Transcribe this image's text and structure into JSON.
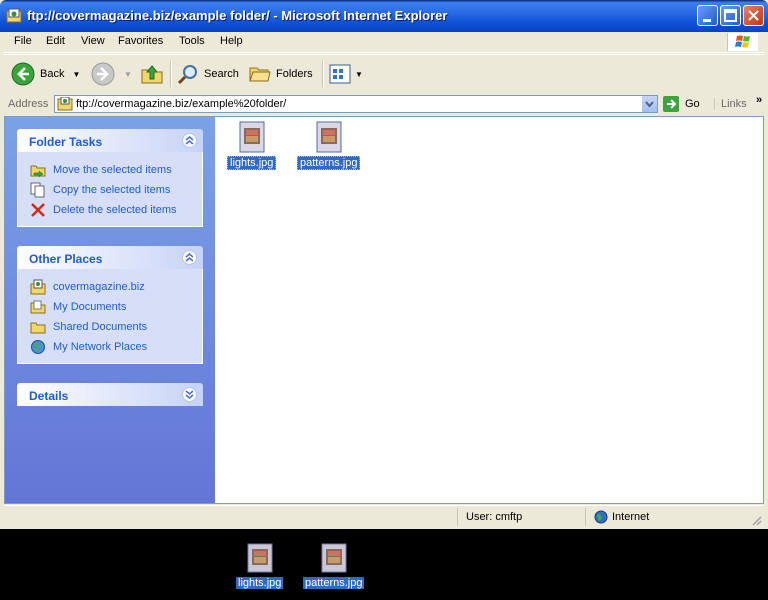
{
  "window": {
    "title": "ftp://covermagazine.biz/example folder/ - Microsoft Internet Explorer"
  },
  "menu": {
    "items": [
      "File",
      "Edit",
      "View",
      "Favorites",
      "Tools",
      "Help"
    ]
  },
  "toolbar": {
    "back_label": "Back",
    "search_label": "Search",
    "folders_label": "Folders"
  },
  "address": {
    "label": "Address",
    "url": "ftp://covermagazine.biz/example%20folder/",
    "go_label": "Go",
    "links_label": "Links"
  },
  "folder_tasks": {
    "title": "Folder Tasks",
    "items": [
      {
        "label": "Move the selected items",
        "icon": "move-icon"
      },
      {
        "label": "Copy the selected items",
        "icon": "copy-icon"
      },
      {
        "label": "Delete the selected items",
        "icon": "delete-icon"
      }
    ]
  },
  "other_places": {
    "title": "Other Places",
    "items": [
      {
        "label": "covermagazine.biz",
        "icon": "ftp-site-icon"
      },
      {
        "label": "My Documents",
        "icon": "my-documents-icon"
      },
      {
        "label": "Shared Documents",
        "icon": "folder-icon"
      },
      {
        "label": "My Network Places",
        "icon": "network-places-icon"
      }
    ]
  },
  "details": {
    "title": "Details"
  },
  "files": [
    {
      "name": "lights.jpg",
      "selected": true
    },
    {
      "name": "patterns.jpg",
      "selected": true
    }
  ],
  "status": {
    "user": "User: cmftp",
    "zone": "Internet"
  },
  "desktop": {
    "files": [
      {
        "name": "lights.jpg"
      },
      {
        "name": "patterns.jpg"
      }
    ]
  },
  "colors": {
    "titlebar": "#0f52d9",
    "link": "#215dc6",
    "selection": "#316ac5",
    "task_pane": "#7ba2e7"
  }
}
